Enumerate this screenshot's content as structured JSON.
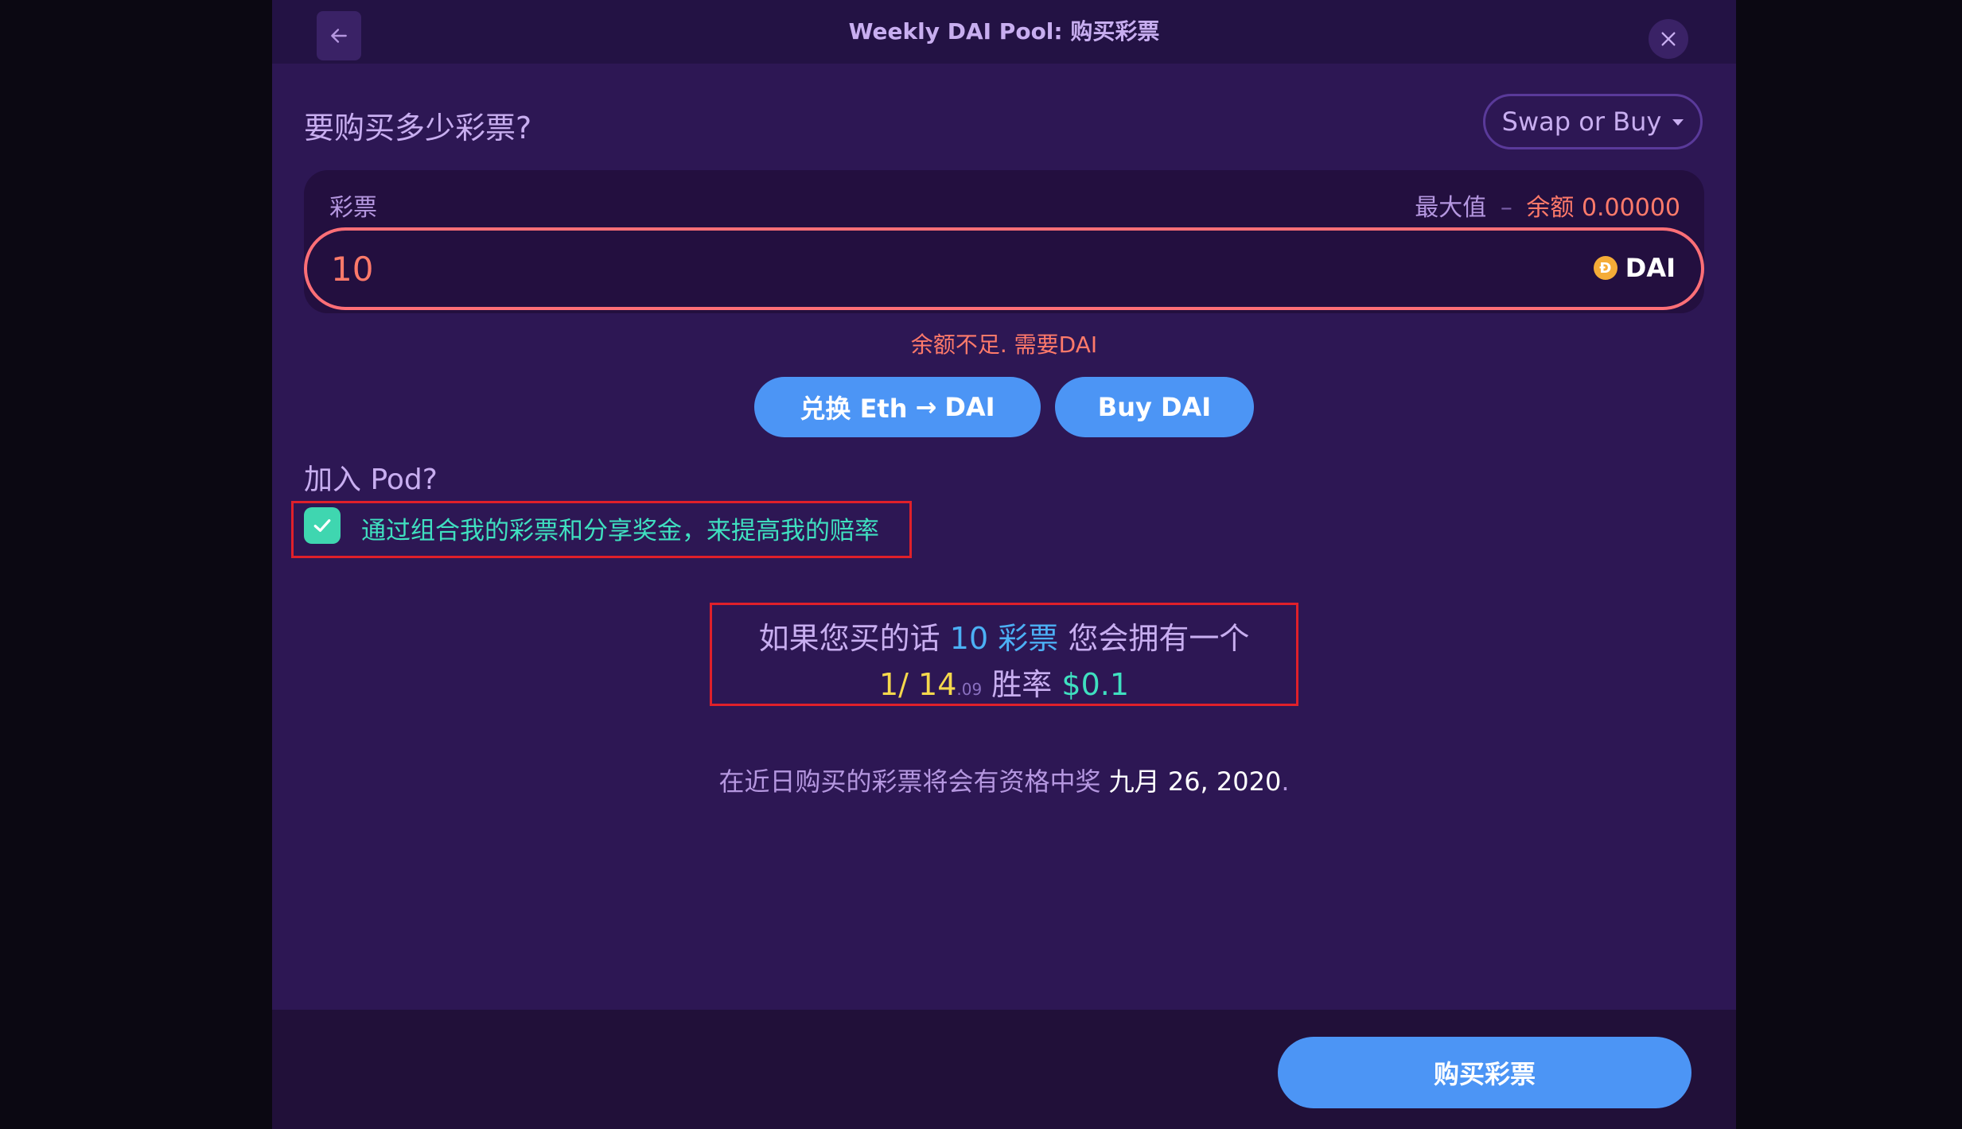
{
  "header": {
    "title": "Weekly DAI Pool: 购买彩票",
    "back_icon": "arrow-left-icon",
    "close_icon": "close-icon"
  },
  "question": "要购买多少彩票?",
  "swap_or_buy": {
    "label": "Swap or Buy"
  },
  "ticket_input": {
    "label": "彩票",
    "max_label": "最大值",
    "separator": "–",
    "balance_label": "余额",
    "balance_value": "0.00000",
    "value": "10",
    "token": "DAI",
    "token_icon_glyph": "Đ"
  },
  "error": "余额不足. 需要DAI",
  "actions": {
    "swap_prefix": "兑换 Eth",
    "swap_arrow": "→",
    "swap_suffix": "DAI",
    "buy_dai": "Buy DAI"
  },
  "pod": {
    "label": "加入 Pod?",
    "checked": true,
    "text": "通过组合我的彩票和分享奖金，来提高我的赔率"
  },
  "odds": {
    "prefix": "如果您买的话",
    "tickets": "10",
    "tickets_unit": "彩票",
    "suffix": "您会拥有一个",
    "ratio": "1/ 14",
    "ratio_decimal": ".09",
    "win_label": "胜率",
    "prize": "$0.1"
  },
  "eligible": {
    "text": "在近日购买的彩票将会有资格中奖",
    "date": "九月 26, 2020",
    "period": "."
  },
  "footer": {
    "buy_button": "购买彩票"
  },
  "colors": {
    "background": "#2d1754",
    "accent_blue": "#4c95f5",
    "error": "#ff6f77",
    "teal": "#3fd6b0"
  }
}
